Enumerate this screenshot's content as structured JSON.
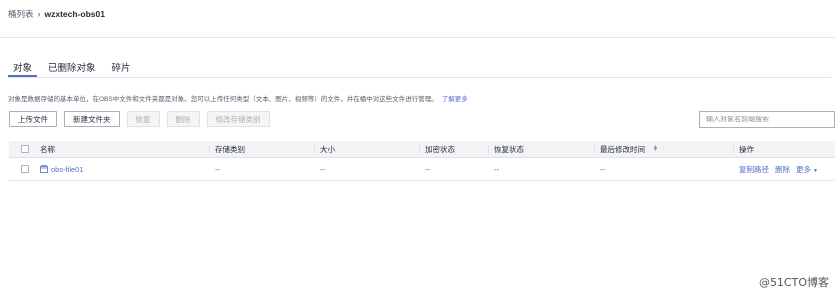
{
  "breadcrumb": {
    "root": "桶列表",
    "separator": "›",
    "current": "wzxtech-obs01"
  },
  "tabs": [
    {
      "label": "对象",
      "active": true
    },
    {
      "label": "已删除对象",
      "active": false
    },
    {
      "label": "碎片",
      "active": false
    }
  ],
  "description": {
    "text": "对象是数据存储的基本单位，在OBS中文件和文件夹都是对象。您可以上传任何类型（文本、图片、视频等）的文件，并在桶中对这些文件进行管理。",
    "link": "了解更多"
  },
  "toolbar": {
    "upload": "上传文件",
    "new_folder": "新建文件夹",
    "restore": "恢复",
    "delete": "删除",
    "change_class": "修改存储类别"
  },
  "search": {
    "placeholder": "输入对象名前缀搜索"
  },
  "table": {
    "headers": {
      "name": "名称",
      "storage_class": "存储类别",
      "size": "大小",
      "encryption": "加密状态",
      "restore_status": "恢复状态",
      "last_modified": "最后修改时间",
      "operation": "操作"
    },
    "rows": [
      {
        "name": "obs-file01",
        "storage_class": "--",
        "size": "--",
        "encryption": "--",
        "restore_status": "--",
        "last_modified": "--",
        "ops": {
          "copy_path": "复制路径",
          "delete": "删除",
          "more": "更多"
        }
      }
    ]
  },
  "watermark": "@51CTO博客",
  "colors": {
    "accent": "#526ecc",
    "header_bg": "#f2f3f5"
  }
}
